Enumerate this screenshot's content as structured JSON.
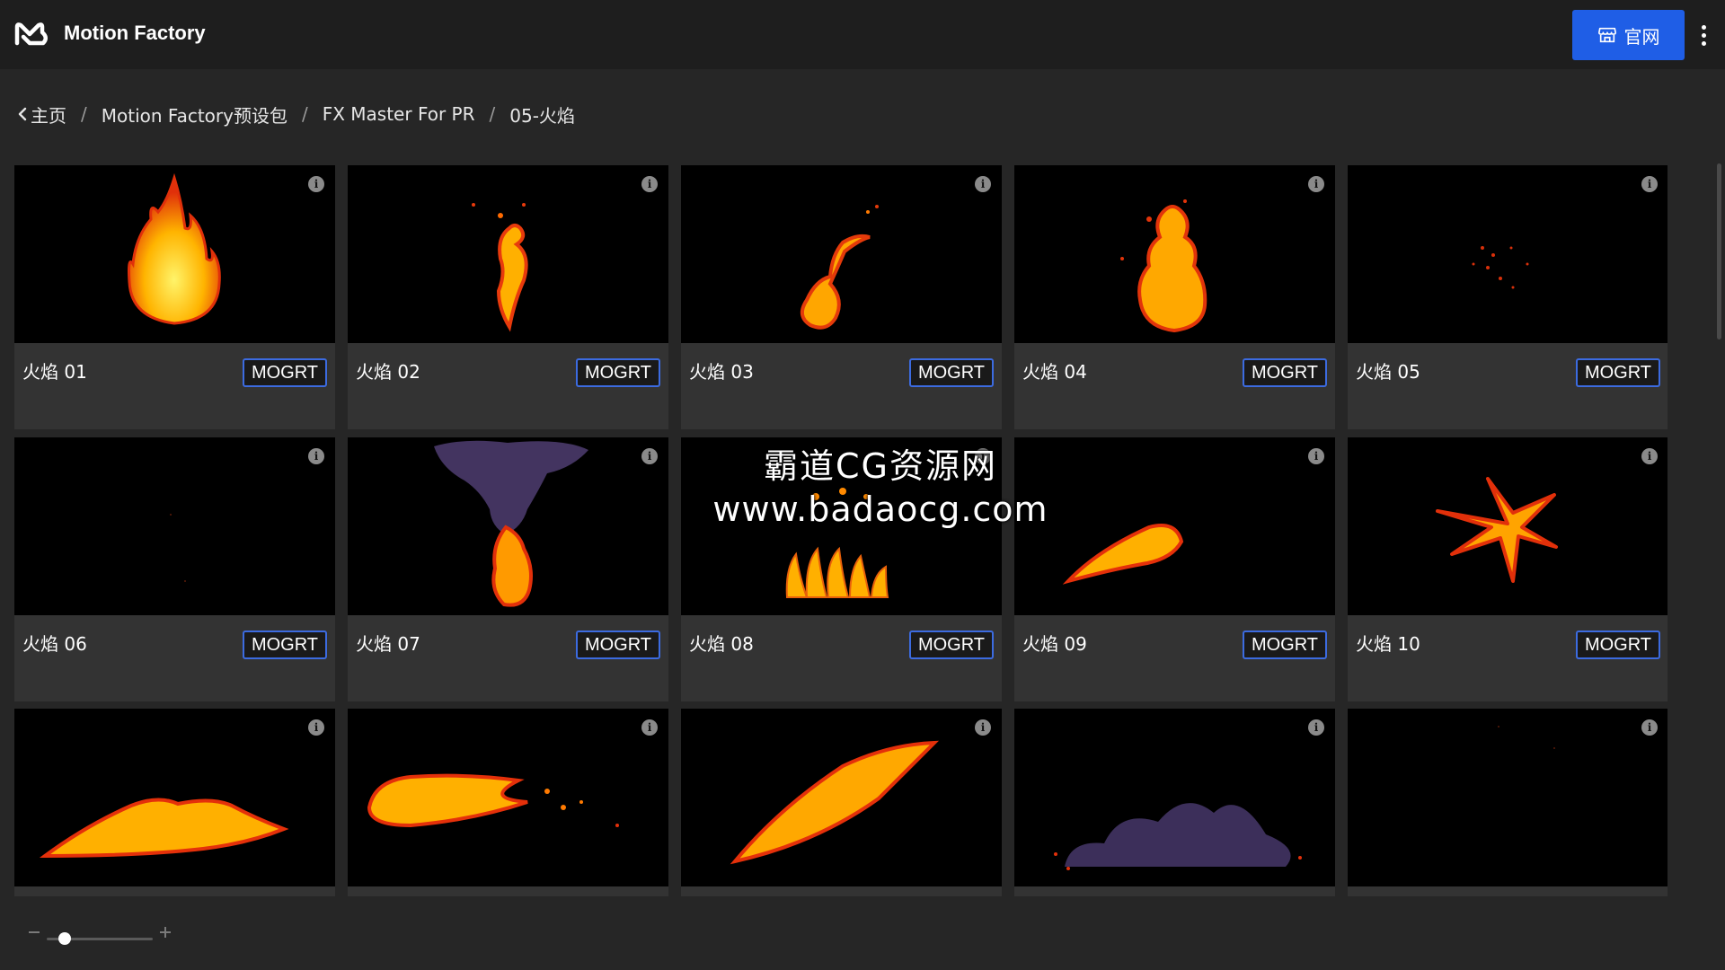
{
  "header": {
    "brand": "Motion Factory",
    "site_button_label": "官网",
    "accent_color": "#1f5ee6"
  },
  "breadcrumb": {
    "items": [
      "主页",
      "Motion Factory预设包",
      "FX Master For PR",
      "05-火焰"
    ],
    "separator": "/"
  },
  "cards": [
    {
      "title": "火焰 01",
      "badge": "MOGRT"
    },
    {
      "title": "火焰 02",
      "badge": "MOGRT"
    },
    {
      "title": "火焰 03",
      "badge": "MOGRT"
    },
    {
      "title": "火焰 04",
      "badge": "MOGRT"
    },
    {
      "title": "火焰 05",
      "badge": "MOGRT"
    },
    {
      "title": "火焰 06",
      "badge": "MOGRT"
    },
    {
      "title": "火焰 07",
      "badge": "MOGRT"
    },
    {
      "title": "火焰 08",
      "badge": "MOGRT"
    },
    {
      "title": "火焰 09",
      "badge": "MOGRT"
    },
    {
      "title": "火焰 10",
      "badge": "MOGRT"
    },
    {
      "title": "",
      "badge": ""
    },
    {
      "title": "",
      "badge": ""
    },
    {
      "title": "",
      "badge": ""
    },
    {
      "title": "",
      "badge": ""
    },
    {
      "title": "",
      "badge": ""
    }
  ],
  "watermark": {
    "line1": "霸道CG资源网",
    "line2": "www.badaocg.com"
  },
  "zoom": {
    "level": 0.17
  },
  "icons": {
    "logo": "motion-factory-logo",
    "site": "storefront-icon",
    "more": "vertical-dots-icon",
    "back": "chevron-left-icon",
    "info": "info-icon",
    "zoom_out": "minus-icon",
    "zoom_in": "plus-icon"
  }
}
